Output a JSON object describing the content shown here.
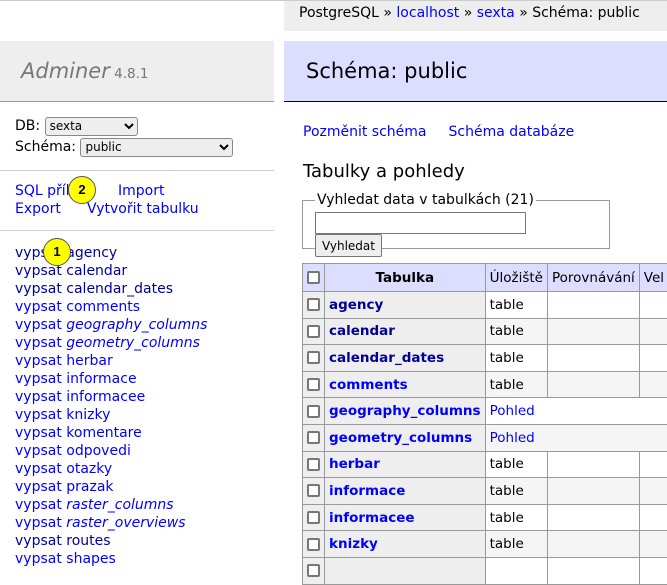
{
  "breadcrumb": {
    "driver": "PostgreSQL",
    "sep": " » ",
    "server": "localhost",
    "db": "sexta",
    "current": "Schéma: public"
  },
  "app": {
    "name": "Adminer",
    "version": "4.8.1"
  },
  "db_select": {
    "label": "DB:",
    "value": "sexta",
    "schema_label": "Schéma:",
    "schema_value": "public"
  },
  "menu_links": {
    "sql": "SQL příkaz",
    "import": "Import",
    "export": "Export",
    "create": "Vytvořit tabulku"
  },
  "sidebar_tables": [
    {
      "verb": "vypsat",
      "name": "agency",
      "view": false,
      "visited": true
    },
    {
      "verb": "vypsat",
      "name": "calendar",
      "view": false,
      "visited": true
    },
    {
      "verb": "vypsat",
      "name": "calendar_dates",
      "view": false,
      "visited": true
    },
    {
      "verb": "vypsat",
      "name": "comments",
      "view": false,
      "visited": false
    },
    {
      "verb": "vypsat",
      "name": "geography_columns",
      "view": true,
      "visited": false
    },
    {
      "verb": "vypsat",
      "name": "geometry_columns",
      "view": true,
      "visited": false
    },
    {
      "verb": "vypsat",
      "name": "herbar",
      "view": false,
      "visited": false
    },
    {
      "verb": "vypsat",
      "name": "informace",
      "view": false,
      "visited": false
    },
    {
      "verb": "vypsat",
      "name": "informacee",
      "view": false,
      "visited": false
    },
    {
      "verb": "vypsat",
      "name": "knizky",
      "view": false,
      "visited": false
    },
    {
      "verb": "vypsat",
      "name": "komentare",
      "view": false,
      "visited": false
    },
    {
      "verb": "vypsat",
      "name": "odpovedi",
      "view": false,
      "visited": false
    },
    {
      "verb": "vypsat",
      "name": "otazky",
      "view": false,
      "visited": false
    },
    {
      "verb": "vypsat",
      "name": "prazak",
      "view": false,
      "visited": false
    },
    {
      "verb": "vypsat",
      "name": "raster_columns",
      "view": true,
      "visited": false
    },
    {
      "verb": "vypsat",
      "name": "raster_overviews",
      "view": true,
      "visited": false
    },
    {
      "verb": "vypsat",
      "name": "routes",
      "view": false,
      "visited": true
    },
    {
      "verb": "vypsat",
      "name": "shapes",
      "view": false,
      "visited": false
    }
  ],
  "main": {
    "title": "Schéma: public",
    "links": {
      "alter": "Pozměnit schéma",
      "diagram": "Schéma databáze"
    },
    "section_title": "Tabulky a pohledy",
    "search": {
      "legend": "Vyhledat data v tabulkách (21)",
      "value": "",
      "button": "Vyhledat"
    },
    "columns": [
      "Tabulka",
      "Úložiště",
      "Porovnávání",
      "Vel"
    ],
    "rows": [
      {
        "name": "agency",
        "engine": "table",
        "visited": true
      },
      {
        "name": "calendar",
        "engine": "table",
        "visited": true
      },
      {
        "name": "calendar_dates",
        "engine": "table",
        "visited": true
      },
      {
        "name": "comments",
        "engine": "table",
        "visited": false
      },
      {
        "name": "geography_columns",
        "engine": "Pohled",
        "visited": false
      },
      {
        "name": "geometry_columns",
        "engine": "Pohled",
        "visited": false
      },
      {
        "name": "herbar",
        "engine": "table",
        "visited": false
      },
      {
        "name": "informace",
        "engine": "table",
        "visited": false
      },
      {
        "name": "informacee",
        "engine": "table",
        "visited": false
      },
      {
        "name": "knizky",
        "engine": "table",
        "visited": false
      },
      {
        "name": "",
        "engine": "",
        "visited": false
      }
    ]
  },
  "annotations": [
    "1",
    "2"
  ]
}
